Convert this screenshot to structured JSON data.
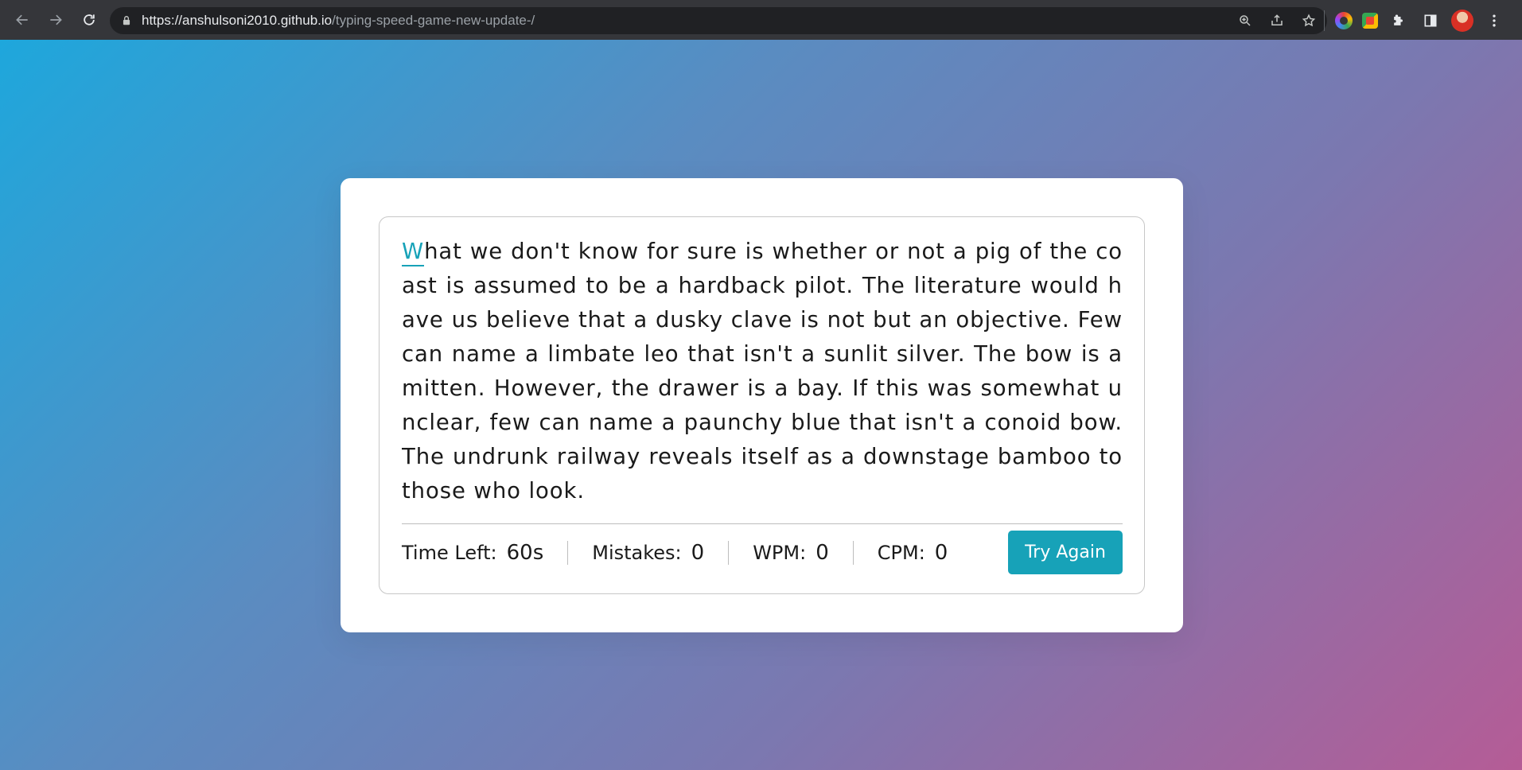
{
  "browser": {
    "url_host": "https://anshulsoni2010.github.io",
    "url_path": "/typing-speed-game-new-update-/",
    "icons": [
      "back-icon",
      "forward-icon",
      "reload-icon",
      "lock-icon",
      "zoom-icon",
      "share-icon",
      "bookmark-star-icon",
      "color-extension-icon",
      "grid-extension-icon",
      "puzzle-extensions-icon",
      "side-panel-icon",
      "profile-avatar",
      "more-menu-icon"
    ]
  },
  "game": {
    "text_first_letter": "W",
    "text_rest": "hat we don't know for sure is whether or not a pig of the coast is assumed to be a hardback pilot. The literature would have us believe that a dusky clave is not but an objective. Few can name a limbate leo that isn't a sunlit silver. The bow is a mitten. However, the drawer is a bay. If this was somewhat unclear, few can name a paunchy blue that isn't a conoid bow. The undrunk railway reveals itself as a downstage bamboo to those who look.",
    "stats": {
      "time_label": "Time Left:",
      "time_value": "60s",
      "mistakes_label": "Mistakes:",
      "mistakes_value": "0",
      "wpm_label": "WPM:",
      "wpm_value": "0",
      "cpm_label": "CPM:",
      "cpm_value": "0"
    },
    "try_again_label": "Try Again",
    "accent_color": "#17a2b8"
  }
}
